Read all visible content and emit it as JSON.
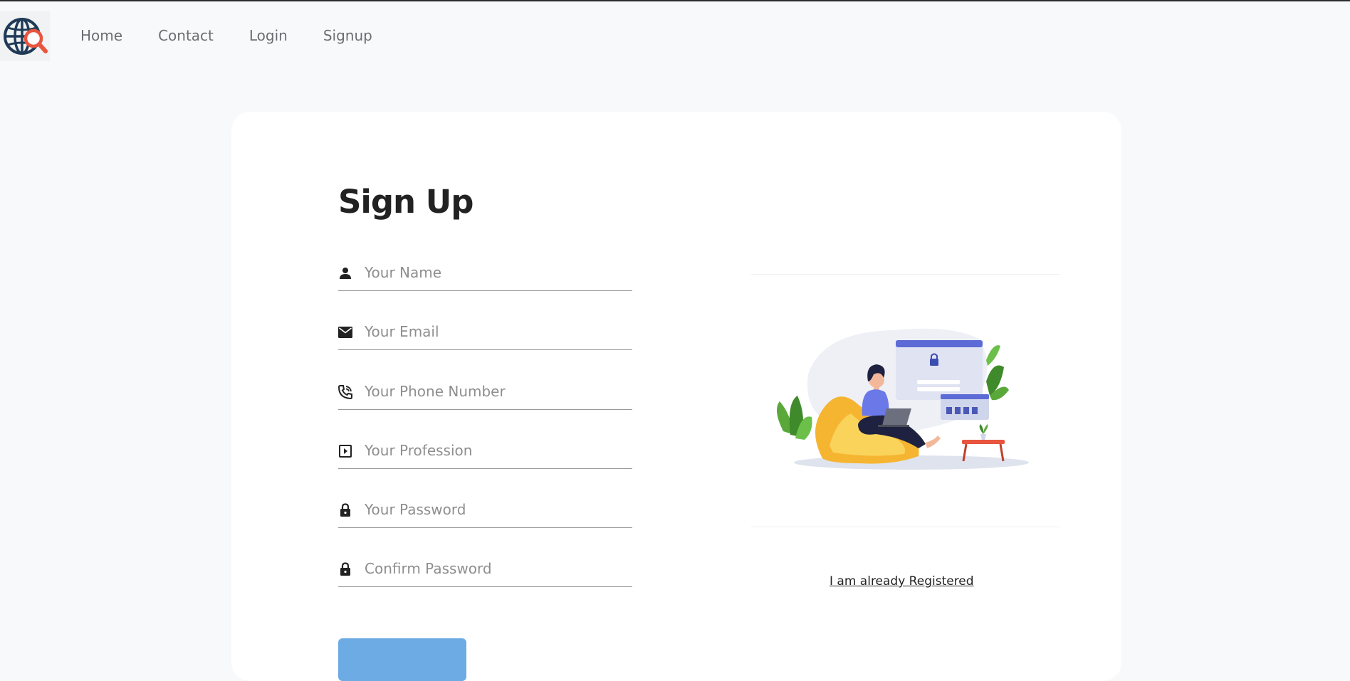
{
  "navbar": {
    "logo_icon": "globe-search-icon",
    "links": [
      {
        "label": "Home"
      },
      {
        "label": "Contact"
      },
      {
        "label": "Login"
      },
      {
        "label": "Signup"
      }
    ]
  },
  "form": {
    "title": "Sign Up",
    "fields": [
      {
        "icon": "person-icon",
        "placeholder": "Your Name",
        "value": ""
      },
      {
        "icon": "email-icon",
        "placeholder": "Your Email",
        "value": ""
      },
      {
        "icon": "phone-icon",
        "placeholder": "Your Phone Number",
        "value": ""
      },
      {
        "icon": "profession-icon",
        "placeholder": "Your Profession",
        "value": ""
      },
      {
        "icon": "lock-icon",
        "placeholder": "Your Password",
        "value": ""
      },
      {
        "icon": "lock-icon",
        "placeholder": "Confirm Password",
        "value": ""
      }
    ]
  },
  "aside": {
    "illustration": "signup-illustration",
    "already_registered_label": "I am already Registered"
  },
  "colors": {
    "background": "#f8f9fa",
    "card": "#ffffff",
    "button": "#6dabe4",
    "text_dark": "#222222",
    "logo_blue": "#1f3b57",
    "logo_orange": "#e8553e"
  }
}
